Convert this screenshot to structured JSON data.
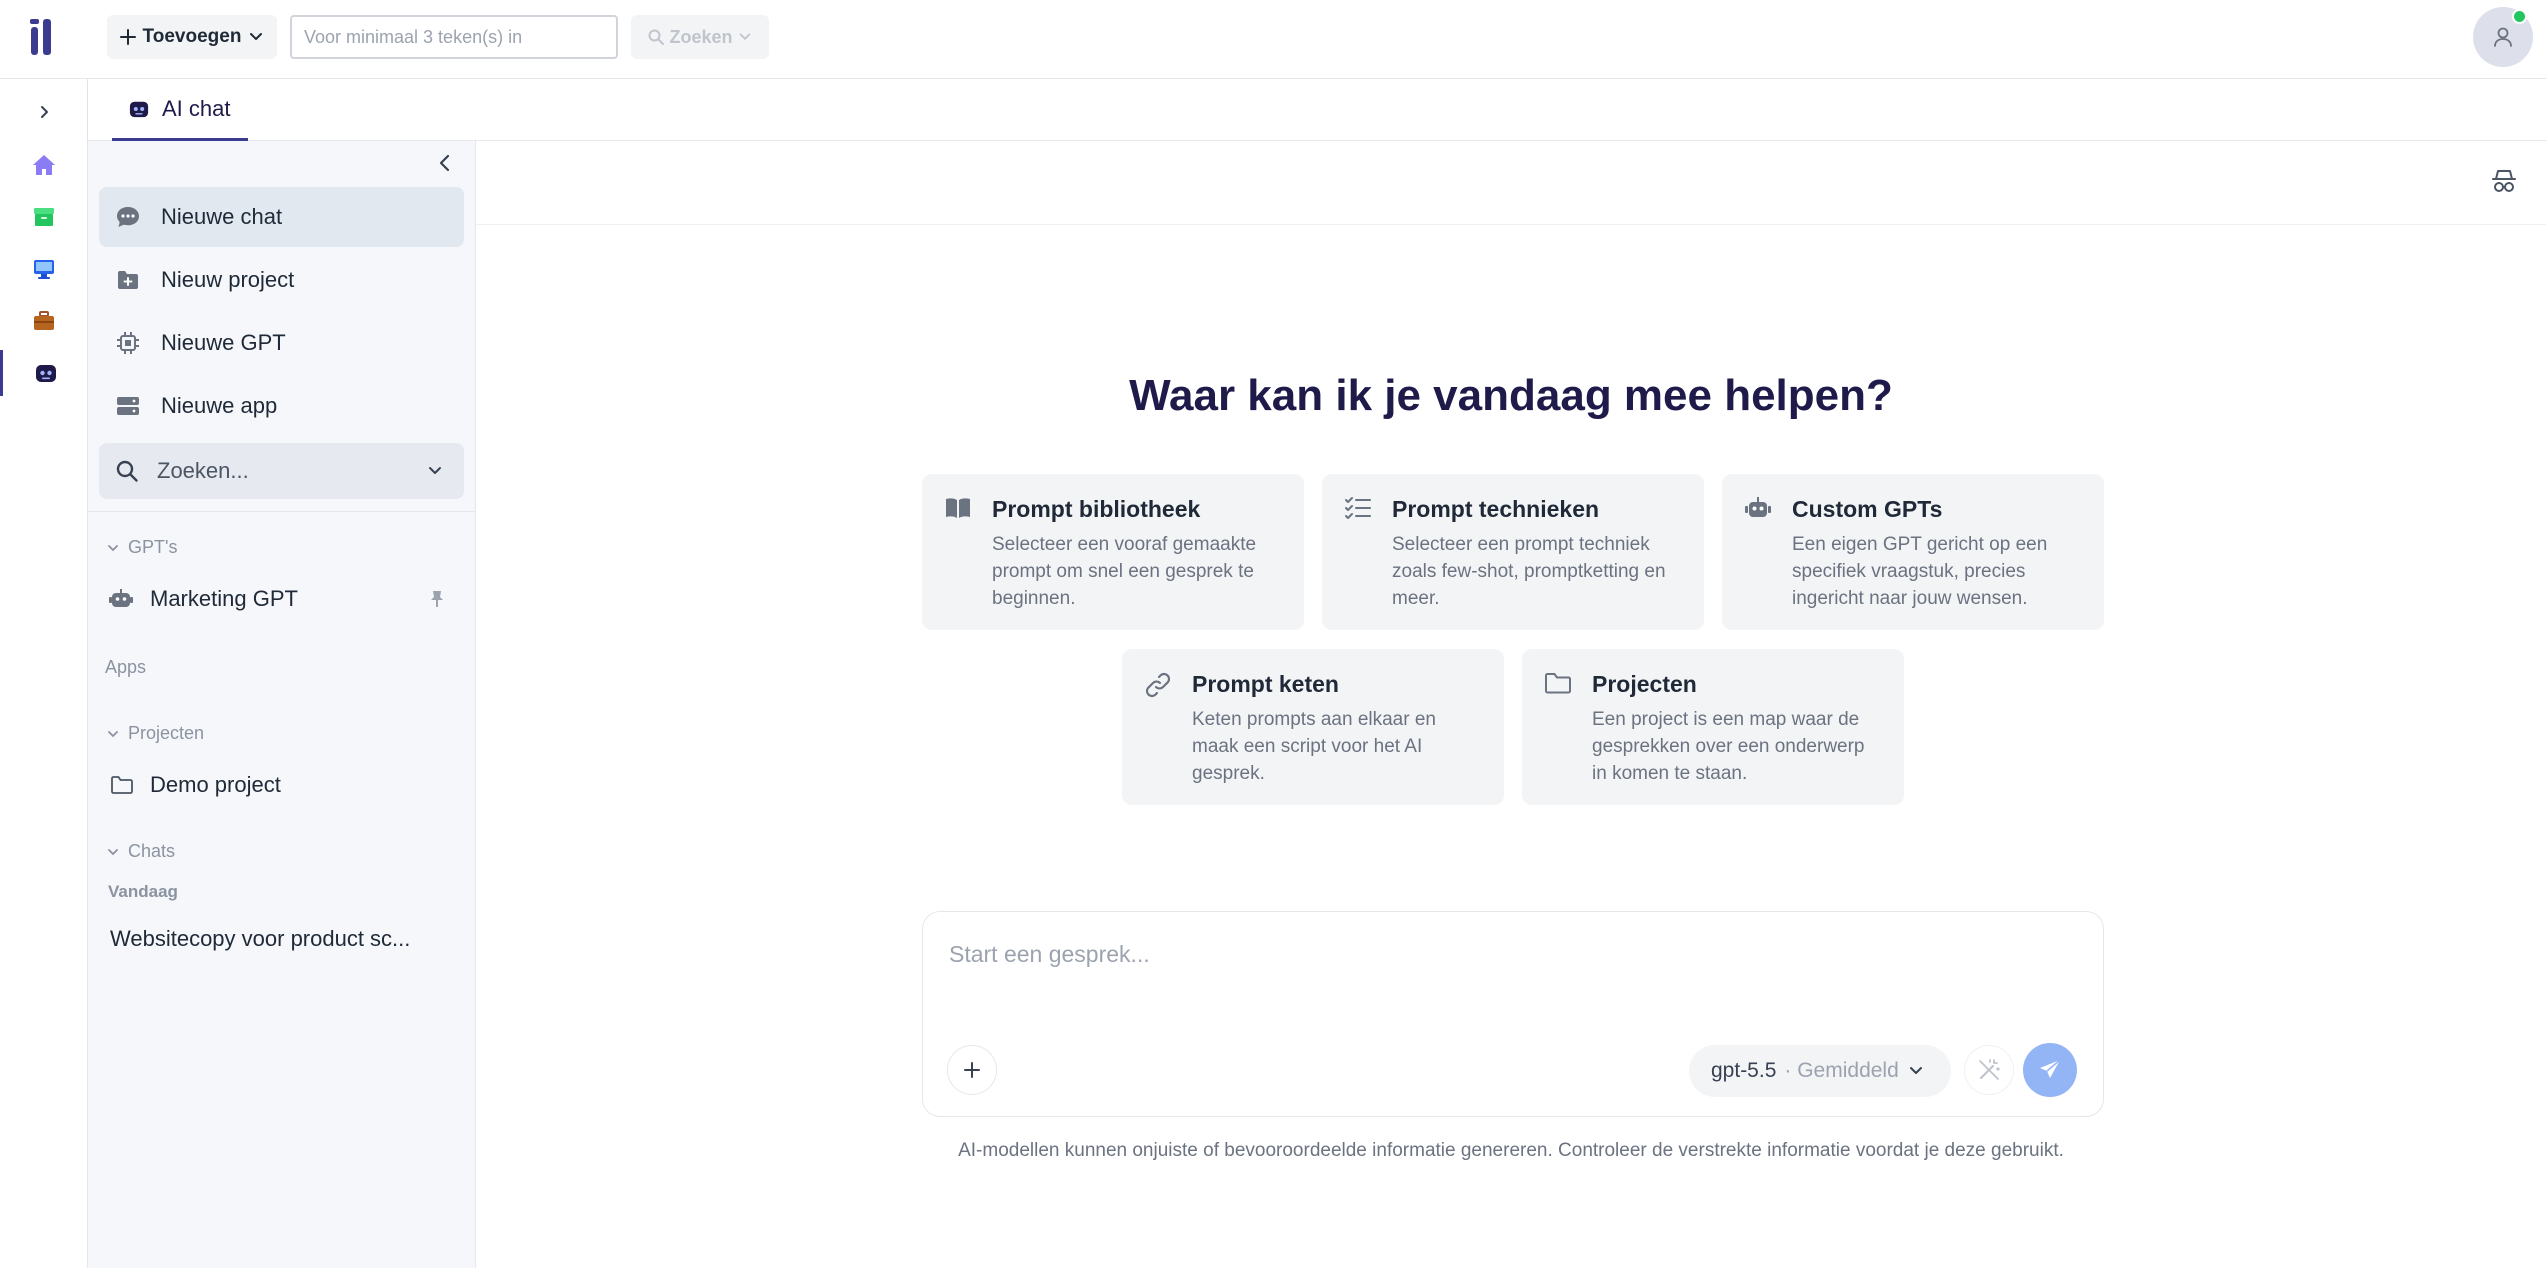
{
  "topbar": {
    "add_label": "Toevoegen",
    "search_placeholder": "Voor minimaal 3 teken(s) in",
    "search_button": "Zoeken"
  },
  "tabs": [
    {
      "label": "AI chat",
      "icon": "robot-icon"
    }
  ],
  "sidebar": {
    "actions": [
      {
        "label": "Nieuwe chat",
        "icon": "chat-bubble-icon"
      },
      {
        "label": "Nieuw project",
        "icon": "folder-plus-icon"
      },
      {
        "label": "Nieuwe GPT",
        "icon": "chip-icon"
      },
      {
        "label": "Nieuwe app",
        "icon": "server-icon"
      }
    ],
    "search_placeholder": "Zoeken...",
    "sections": {
      "gpts": {
        "label": "GPT's",
        "items": [
          "Marketing GPT"
        ]
      },
      "apps": {
        "label": "Apps"
      },
      "projects": {
        "label": "Projecten",
        "items": [
          "Demo project"
        ]
      },
      "chats": {
        "label": "Chats",
        "group": "Vandaag",
        "items": [
          "Websitecopy voor product sc..."
        ]
      }
    }
  },
  "main": {
    "hero_title": "Waar kan ik je vandaag mee helpen?",
    "cards": [
      {
        "title": "Prompt bibliotheek",
        "desc": "Selecteer een vooraf gemaakte prompt om snel een gesprek te beginnen.",
        "icon": "book-icon"
      },
      {
        "title": "Prompt technieken",
        "desc": "Selecteer een prompt techniek zoals few-shot, promptketting en meer.",
        "icon": "checklist-icon"
      },
      {
        "title": "Custom GPTs",
        "desc": "Een eigen GPT gericht op een specifiek vraagstuk, precies ingericht naar jouw wensen.",
        "icon": "robot-icon"
      },
      {
        "title": "Prompt keten",
        "desc": "Keten prompts aan elkaar en maak een script voor het AI gesprek.",
        "icon": "link-icon"
      },
      {
        "title": "Projecten",
        "desc": "Een project is een map waar de gesprekken over een onderwerp in komen te staan.",
        "icon": "folder-icon"
      }
    ],
    "composer": {
      "placeholder": "Start een gesprek...",
      "model": "gpt-5.5",
      "mode": "· Gemiddeld"
    },
    "disclaimer": "AI-modellen kunnen onjuiste of bevooroordeelde informatie genereren. Controleer de verstrekte informatie voordat je deze gebruikt."
  },
  "colors": {
    "brand": "#3b3b8f",
    "title": "#1e1b4b",
    "status_online": "#22c55e",
    "send": "#93b4f5"
  }
}
